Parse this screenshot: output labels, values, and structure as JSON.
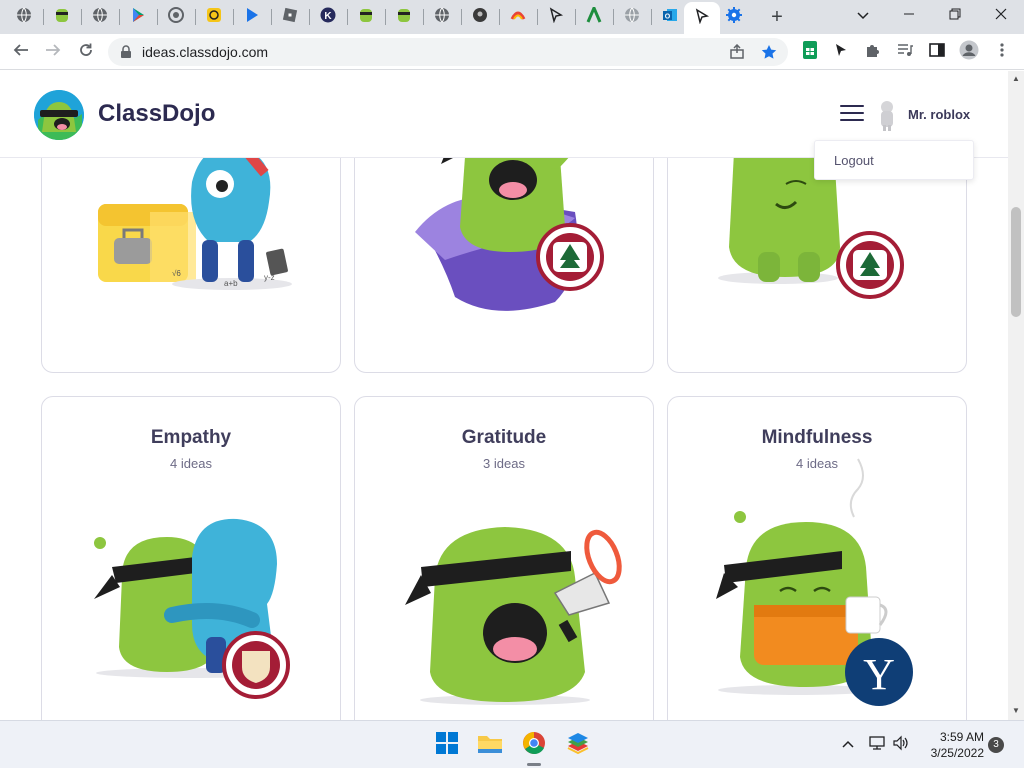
{
  "browser": {
    "tabs": [
      {
        "icon": "globe-icon"
      },
      {
        "icon": "classdojo-monster-icon"
      },
      {
        "icon": "globe-icon"
      },
      {
        "icon": "google-play-icon"
      },
      {
        "icon": "chrome-icon"
      },
      {
        "icon": "yellow-circle-app-icon"
      },
      {
        "icon": "google-play-icon"
      },
      {
        "icon": "roblox-icon"
      },
      {
        "icon": "k-letter-icon"
      },
      {
        "icon": "classdojo-monster-icon"
      },
      {
        "icon": "classdojo-monster-icon"
      },
      {
        "icon": "globe-icon"
      },
      {
        "icon": "dark-circle-icon"
      },
      {
        "icon": "colorful-app-icon"
      },
      {
        "icon": "cursor-arrow-icon"
      },
      {
        "icon": "green-a-icon"
      },
      {
        "icon": "globe-icon"
      },
      {
        "icon": "outlook-icon"
      },
      {
        "icon": "cursor-arrow-icon",
        "active": true
      },
      {
        "icon": "settings-gear-icon"
      }
    ],
    "new_tab_label": "+",
    "url": "ideas.classdojo.com"
  },
  "site": {
    "brand": "ClassDojo",
    "user_name": "Mr. roblox",
    "menu": {
      "logout": "Logout"
    }
  },
  "cards_top": [
    {
      "name": "top-card-1",
      "badge": "none"
    },
    {
      "name": "top-card-2",
      "badge": "stanford"
    },
    {
      "name": "top-card-3",
      "badge": "stanford"
    }
  ],
  "cards": [
    {
      "title": "Empathy",
      "subtitle": "4 ideas",
      "badge": "harvard"
    },
    {
      "title": "Gratitude",
      "subtitle": "3 ideas",
      "badge": "none"
    },
    {
      "title": "Mindfulness",
      "subtitle": "4 ideas",
      "badge": "yale",
      "badge_text": "Y"
    }
  ],
  "taskbar": {
    "apps": [
      "windows-start-icon",
      "file-explorer-icon",
      "chrome-icon",
      "bluestacks-icon"
    ],
    "time": "3:59 AM",
    "date": "3/25/2022",
    "notifications": "3"
  },
  "colors": {
    "monster_green": "#8dc63f",
    "monster_blue": "#3fb3d9",
    "bandana": "#1e1e1e",
    "cape_purple": "#7c5cc4",
    "stanford_red": "#a41d36",
    "yale_blue": "#0f3e76",
    "robe_orange": "#f28b1f"
  }
}
